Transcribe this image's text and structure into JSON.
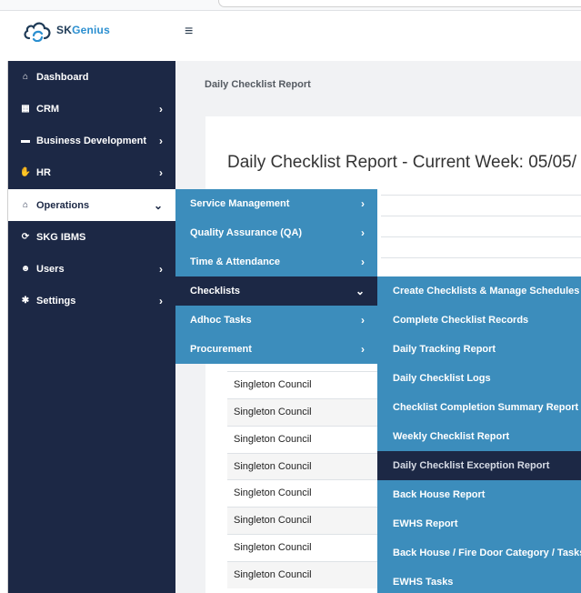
{
  "header": {
    "logo_text_dark": "SK",
    "logo_text_accent": "Genius",
    "menu_toggle": "≡"
  },
  "sidebar": {
    "items": [
      {
        "label": "Dashboard",
        "icon": "home-icon",
        "glyph": "⌂",
        "has_chevron": false,
        "chevron": ""
      },
      {
        "label": "CRM",
        "icon": "building-icon",
        "glyph": "▦",
        "has_chevron": true,
        "chevron": "›"
      },
      {
        "label": "Business Development",
        "icon": "folder-icon",
        "glyph": "▬",
        "has_chevron": true,
        "chevron": "›"
      },
      {
        "label": "HR",
        "icon": "handshake-icon",
        "glyph": "✋",
        "has_chevron": true,
        "chevron": "›"
      },
      {
        "label": "Operations",
        "icon": "house-icon",
        "glyph": "⌂",
        "has_chevron": true,
        "chevron": "⌄",
        "active": true
      },
      {
        "label": "SKG IBMS",
        "icon": "sync-icon",
        "glyph": "⟳",
        "has_chevron": false,
        "chevron": ""
      },
      {
        "label": "Users",
        "icon": "users-icon",
        "glyph": "☻",
        "has_chevron": true,
        "chevron": "›"
      },
      {
        "label": "Settings",
        "icon": "gear-icon",
        "glyph": "✱",
        "has_chevron": true,
        "chevron": "›"
      }
    ]
  },
  "main": {
    "breadcrumb": "Daily Checklist Report",
    "report_title": "Daily Checklist Report - Current Week: 05/05/",
    "rows": [
      "Singleton Council",
      "Singleton Council",
      "Singleton Council",
      "Singleton Council",
      "Singleton Council",
      "Singleton Council",
      "Singleton Council",
      "Singleton Council"
    ]
  },
  "operations_menu": {
    "items": [
      {
        "label": "Service Management",
        "chevron": "›"
      },
      {
        "label": "Quality Assurance (QA)",
        "chevron": "›"
      },
      {
        "label": "Time & Attendance",
        "chevron": "›"
      },
      {
        "label": "Checklists",
        "chevron": "⌄",
        "active": true
      },
      {
        "label": "Adhoc Tasks",
        "chevron": "›"
      },
      {
        "label": "Procurement",
        "chevron": "›"
      }
    ]
  },
  "checklists_menu": {
    "items": [
      {
        "label": "Create Checklists & Manage Schedules"
      },
      {
        "label": "Complete Checklist Records"
      },
      {
        "label": "Daily Tracking Report"
      },
      {
        "label": "Daily Checklist Logs"
      },
      {
        "label": "Checklist Completion Summary Report"
      },
      {
        "label": "Weekly Checklist Report"
      },
      {
        "label": "Daily Checklist Exception Report",
        "active": true
      },
      {
        "label": "Back House Report"
      },
      {
        "label": "EWHS Report"
      },
      {
        "label": "Back House / Fire Door Category / Tasks"
      },
      {
        "label": "EWHS Tasks"
      }
    ]
  },
  "colors": {
    "sidebar_bg": "#1c2845",
    "menu_bg": "#3c8dbc",
    "content_bg": "#f1f2f4"
  }
}
